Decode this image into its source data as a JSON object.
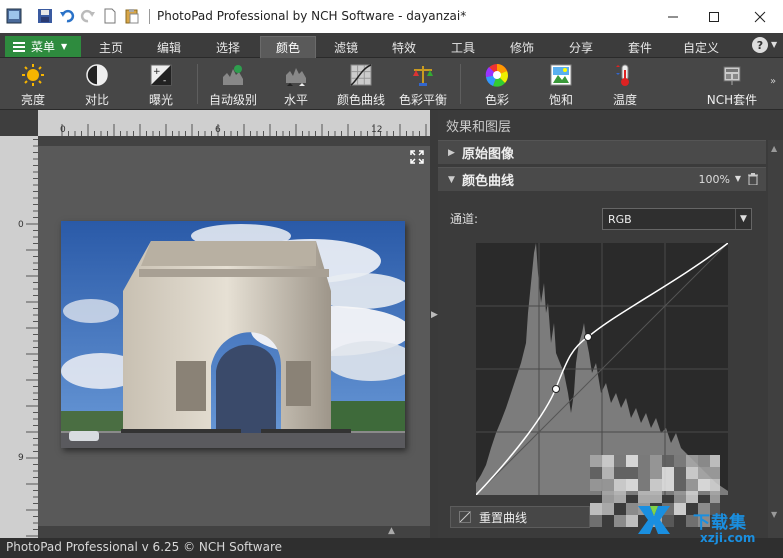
{
  "window": {
    "title": "PhotoPad Professional by NCH Software - dayanzai*",
    "controls": [
      "minimize-icon",
      "maximize-icon",
      "close-icon"
    ]
  },
  "quick_access": [
    "app-icon",
    "save-icon",
    "undo-icon",
    "redo-icon",
    "new-icon",
    "paste-icon"
  ],
  "menubar": {
    "menu_label": "菜单",
    "tabs": [
      "主页",
      "编辑",
      "选择",
      "颜色",
      "滤镜",
      "特效",
      "工具",
      "修饰",
      "分享",
      "套件",
      "自定义"
    ],
    "active_tab": "颜色",
    "help": "?"
  },
  "toolbar": {
    "tools": [
      {
        "label": "亮度",
        "icon": "sun-icon"
      },
      {
        "label": "对比",
        "icon": "contrast-icon"
      },
      {
        "label": "曝光",
        "icon": "exposure-icon"
      },
      {
        "label": "自动级别",
        "icon": "auto-levels-icon"
      },
      {
        "label": "水平",
        "icon": "levels-icon"
      },
      {
        "label": "颜色曲线",
        "icon": "color-curve-icon"
      },
      {
        "label": "色彩平衡",
        "icon": "color-balance-icon"
      },
      {
        "label": "色彩",
        "icon": "color-wheel-icon"
      },
      {
        "label": "饱和",
        "icon": "saturation-icon"
      },
      {
        "label": "温度",
        "icon": "thermometer-icon"
      },
      {
        "label": "NCH套件",
        "icon": "nch-suite-icon"
      }
    ]
  },
  "ruler": {
    "top_labels": [
      "0",
      "6",
      "12"
    ],
    "left_labels": [
      "0",
      "9"
    ]
  },
  "panel": {
    "title": "效果和图层",
    "sections": [
      {
        "name": "原始图像",
        "expanded": false
      },
      {
        "name": "颜色曲线",
        "expanded": true
      }
    ],
    "opacity": "100%",
    "channel_label": "通道:",
    "channel_value": "RGB",
    "reset_label": "重置曲线"
  },
  "status": {
    "text": "PhotoPad Professional v 6.25 © NCH Software"
  },
  "watermark": {
    "text": "下载集",
    "url": "xzji.com"
  },
  "colors": {
    "menu_button": "#2e8b3e",
    "watermark": "#1a8fe0"
  }
}
